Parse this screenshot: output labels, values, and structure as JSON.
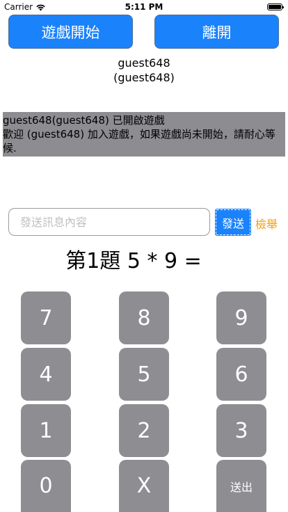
{
  "status_bar": {
    "carrier": "Carrier",
    "time": "5:11 PM"
  },
  "buttons": {
    "start": "遊戲開始",
    "leave": "離開"
  },
  "users": [
    "guest648",
    "(guest648)"
  ],
  "messages": [
    "guest648(guest648) 已開啟遊戲",
    "歡迎 (guest648) 加入遊戲，如果遊戲尚未開始，請耐心等候."
  ],
  "chat": {
    "placeholder": "發送訊息內容",
    "send_label": "發送",
    "report_label": "檢舉"
  },
  "question": "第1題 5 * 9 =",
  "keypad": [
    "7",
    "8",
    "9",
    "4",
    "5",
    "6",
    "1",
    "2",
    "3",
    "0",
    "X",
    "送出"
  ],
  "colors": {
    "accent": "#1a82fb",
    "key_bg": "#8e8e92",
    "log_bg": "#8d8d91",
    "report": "#f39c12"
  }
}
